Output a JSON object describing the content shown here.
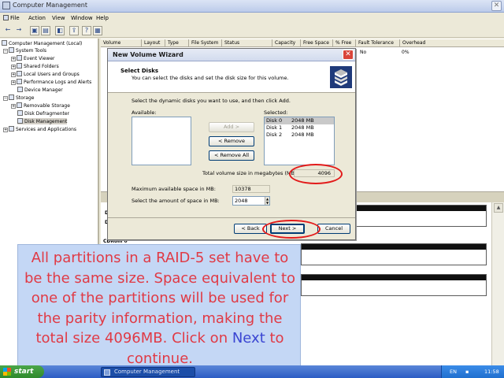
{
  "window": {
    "title": "Computer Management"
  },
  "menu": [
    "File",
    "Action",
    "View",
    "Window",
    "Help"
  ],
  "tree": {
    "root": "Computer Management (Local)",
    "system_tools": "System Tools",
    "event_viewer": "Event Viewer",
    "shared_folders": "Shared Folders",
    "local_users": "Local Users and Groups",
    "perf_logs": "Performance Logs and Alerts",
    "device_manager": "Device Manager",
    "storage": "Storage",
    "removable": "Removable Storage",
    "defrag": "Disk Defragmenter",
    "disk_mgmt": "Disk Management",
    "services": "Services and Applications"
  },
  "columns": [
    "Volume",
    "Layout",
    "Type",
    "File System",
    "Status",
    "Capacity",
    "Free Space",
    "% Free",
    "Fault Tolerance",
    "Overhead"
  ],
  "row": {
    "fault_tolerance": "No",
    "overhead": "0%"
  },
  "disks": {
    "letter_d": "D",
    "letter_d2": "D",
    "cdrom": "CDRom 0"
  },
  "dialog": {
    "title": "New Volume Wizard",
    "heading": "Select Disks",
    "subheading": "You can select the disks and set the disk size for this volume.",
    "instruction": "Select the dynamic disks you want to use, and then click Add.",
    "available_label": "Available:",
    "selected_label": "Selected:",
    "selected_disks": [
      {
        "name": "Disk 0",
        "size": "2048 MB"
      },
      {
        "name": "Disk 1",
        "size": "2048 MB"
      },
      {
        "name": "Disk 2",
        "size": "2048 MB"
      }
    ],
    "add": "Add >",
    "remove": "< Remove",
    "remove_all": "< Remove All",
    "total_label": "Total volume size in megabytes (MB):",
    "total_value": "4096",
    "max_label": "Maximum available space in MB:",
    "max_value": "10378",
    "amount_label": "Select the amount of space in MB:",
    "amount_value": "2048",
    "back": "< Back",
    "next": "Next >",
    "cancel": "Cancel"
  },
  "callout": {
    "text_before": "All partitions in a RAID-5 set have to be the same size. Space equivalent to one of the partitions will be used for the parity information, making the total size 4096MB. Click on ",
    "keyword": "Next",
    "text_after": " to continue."
  },
  "taskbar": {
    "start": "start",
    "task": "Computer Management",
    "lang": "EN",
    "clock": "11:58"
  },
  "colors": {
    "highlight_ring": "#e21a1a",
    "callout_text": "#e03a45",
    "callout_keyword": "#3a45d2",
    "callout_bg": "#c4d7f5"
  }
}
